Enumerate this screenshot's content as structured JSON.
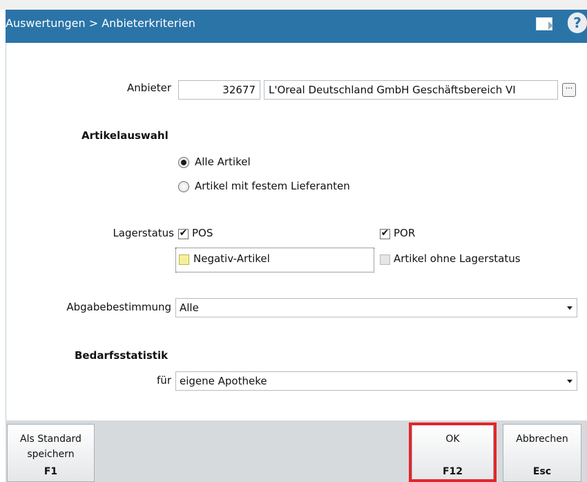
{
  "window": {
    "title": "Auswertungen > Anbieterkriterien",
    "icons": [
      "document-arrow-icon",
      "help-icon"
    ],
    "help_glyph": "?"
  },
  "anbieter": {
    "label": "Anbieter",
    "number": "32677",
    "name": "L'Oreal Deutschland GmbH Geschäftsbereich VI",
    "browse_label": "···"
  },
  "artikelauswahl": {
    "heading": "Artikelauswahl",
    "options": [
      {
        "label": "Alle Artikel",
        "selected": true
      },
      {
        "label": "Artikel mit festem Lieferanten",
        "selected": false
      }
    ]
  },
  "lagerstatus": {
    "label": "Lagerstatus",
    "items": [
      {
        "label": "POS",
        "checked": true
      },
      {
        "label": "POR",
        "checked": true
      },
      {
        "label": "Negativ-Artikel",
        "checked": false
      },
      {
        "label": "Artikel ohne Lagerstatus",
        "checked": false
      }
    ],
    "check_glyph": "✔"
  },
  "abgabebestimmung": {
    "label": "Abgabebestimmung",
    "value": "Alle"
  },
  "bedarfsstatistik": {
    "heading": "Bedarfsstatistik",
    "label": "für",
    "value": "eigene Apotheke"
  },
  "footer": {
    "buttons": [
      {
        "line1": "Als Standard",
        "line2": "speichern",
        "key": "F1"
      },
      {
        "line1": "OK",
        "line2": "",
        "key": "F12"
      },
      {
        "line1": "Abbrechen",
        "line2": "",
        "key": "Esc"
      }
    ]
  },
  "colors": {
    "title_bar": "#2b74a8",
    "highlight": "#e2262b",
    "footer": "#d6dadd"
  }
}
